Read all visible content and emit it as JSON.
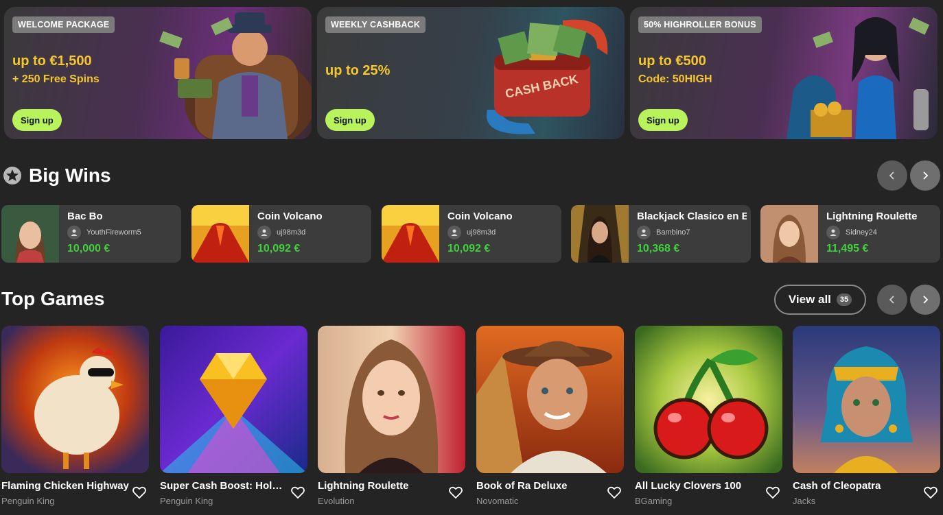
{
  "promos": [
    {
      "tag": "WELCOME PACKAGE",
      "headline": "up to €1,500",
      "sub": "+ 250 Free Spins",
      "cta": "Sign up"
    },
    {
      "tag": "WEEKLY CASHBACK",
      "headline": "up to 25%",
      "sub": "",
      "cta": "Sign up",
      "art_text": "CASH BACK"
    },
    {
      "tag": "50% HIGHROLLER BONUS",
      "headline": "up to €500",
      "sub": "Code: 50HIGH",
      "cta": "Sign up"
    }
  ],
  "big_wins": {
    "title": "Big Wins",
    "items": [
      {
        "game": "Bac Bo",
        "user": "YouthFireworm5",
        "amount": "10,000 €"
      },
      {
        "game": "Coin Volcano",
        "user": "uj98m3d",
        "amount": "10,092 €"
      },
      {
        "game": "Coin Volcano",
        "user": "uj98m3d",
        "amount": "10,092 €"
      },
      {
        "game": "Blackjack Clasico en E",
        "user": "Bambino7",
        "amount": "10,368 €"
      },
      {
        "game": "Lightning Roulette",
        "user": "Sidney24",
        "amount": "11,495 €"
      }
    ]
  },
  "top_games": {
    "title": "Top Games",
    "view_all_label": "View all",
    "view_all_count": "35",
    "items": [
      {
        "title": "Flaming Chicken Highway",
        "provider": "Penguin King"
      },
      {
        "title": "Super Cash Boost: Hold and Win",
        "provider": "Penguin King"
      },
      {
        "title": "Lightning Roulette",
        "provider": "Evolution"
      },
      {
        "title": "Book of Ra Deluxe",
        "provider": "Novomatic"
      },
      {
        "title": "All Lucky Clovers 100",
        "provider": "BGaming"
      },
      {
        "title": "Cash of Cleopatra",
        "provider": "Jacks"
      }
    ]
  },
  "colors": {
    "accent_green": "#b9f35b",
    "win_green": "#3fd23a",
    "gold": "#f5c72d"
  }
}
